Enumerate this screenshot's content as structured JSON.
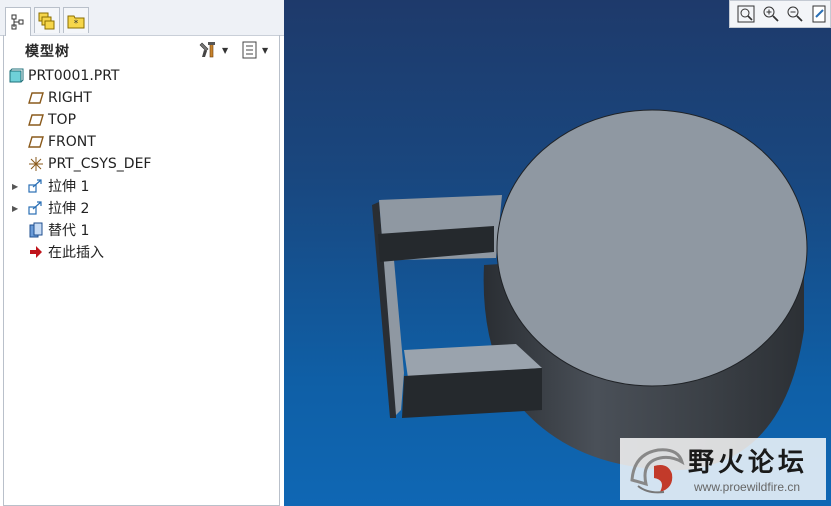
{
  "tabs": [
    {
      "icon": "model-tree-icon",
      "active": true
    },
    {
      "icon": "layers-icon",
      "active": false
    },
    {
      "icon": "favorites-folder-icon",
      "active": false
    }
  ],
  "tree": {
    "title": "模型树",
    "settings_icon": "tools-icon",
    "show_icon": "list-icon",
    "items": [
      {
        "label": "PRT0001.PRT",
        "icon": "part-icon",
        "level": 0,
        "expandable": false
      },
      {
        "label": "RIGHT",
        "icon": "datum-plane-icon",
        "level": 1,
        "expandable": false
      },
      {
        "label": "TOP",
        "icon": "datum-plane-icon",
        "level": 1,
        "expandable": false
      },
      {
        "label": "FRONT",
        "icon": "datum-plane-icon",
        "level": 1,
        "expandable": false
      },
      {
        "label": "PRT_CSYS_DEF",
        "icon": "csys-icon",
        "level": 1,
        "expandable": false
      },
      {
        "label": "拉伸 1",
        "icon": "extrude-icon",
        "level": 1,
        "expandable": true
      },
      {
        "label": "拉伸 2",
        "icon": "extrude-icon",
        "level": 1,
        "expandable": true
      },
      {
        "label": "替代 1",
        "icon": "substitute-icon",
        "level": 1,
        "expandable": false
      },
      {
        "label": "在此插入",
        "icon": "insert-here-arrow-icon",
        "level": 1,
        "expandable": false
      }
    ]
  },
  "view_toolbar": {
    "buttons": [
      "refit-icon",
      "zoom-in-icon",
      "zoom-out-icon",
      "repaint-icon"
    ]
  },
  "watermark": {
    "title": "野火论坛",
    "url": "www.proewildfire.cn"
  },
  "colors": {
    "viewport_top": "#1e3a6b",
    "viewport_bottom": "#0f67b4",
    "model_top": "#8f98a2",
    "model_side": "#3b4046"
  }
}
